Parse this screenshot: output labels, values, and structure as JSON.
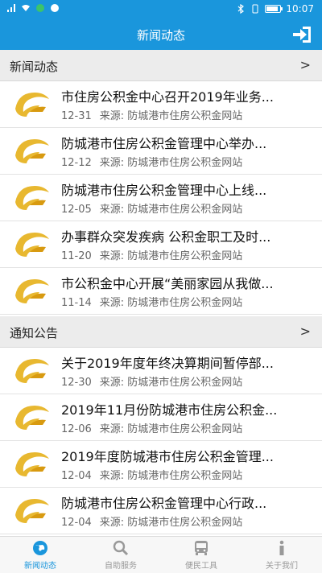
{
  "status_bar": {
    "time": "10:07"
  },
  "header": {
    "title": "新闻动态"
  },
  "sections": [
    {
      "label": "新闻动态",
      "more": ">",
      "items": [
        {
          "title": "市住房公积金中心召开2019年业务...",
          "date": "12-31",
          "source": "来源:  防城港市住房公积金网站"
        },
        {
          "title": "防城港市住房公积金管理中心举办...",
          "date": "12-12",
          "source": "来源:  防城港市住房公积金网站"
        },
        {
          "title": "防城港市住房公积金管理中心上线...",
          "date": "12-05",
          "source": "来源:  防城港市住房公积金网站"
        },
        {
          "title": "办事群众突发疾病 公积金职工及时...",
          "date": "11-20",
          "source": "来源:  防城港市住房公积金网站"
        },
        {
          "title": "市公积金中心开展“美丽家园从我做...",
          "date": "11-14",
          "source": "来源:  防城港市住房公积金网站"
        }
      ]
    },
    {
      "label": "通知公告",
      "more": ">",
      "items": [
        {
          "title": "关于2019年度年终决算期间暂停部...",
          "date": "12-30",
          "source": "来源:  防城港市住房公积金网站"
        },
        {
          "title": "2019年11月份防城港市住房公积金...",
          "date": "12-06",
          "source": "来源:  防城港市住房公积金网站"
        },
        {
          "title": "2019年度防城港市住房公积金管理...",
          "date": "12-04",
          "source": "来源:  防城港市住房公积金网站"
        },
        {
          "title": "防城港市住房公积金管理中心行政...",
          "date": "12-04",
          "source": "来源:  防城港市住房公积金网站"
        }
      ]
    }
  ],
  "tabs": [
    {
      "label": "新闻动态",
      "icon": "globe-icon",
      "active": true
    },
    {
      "label": "自助服务",
      "icon": "search-icon",
      "active": false
    },
    {
      "label": "便民工具",
      "icon": "bus-icon",
      "active": false
    },
    {
      "label": "关于我们",
      "icon": "info-icon",
      "active": false
    }
  ],
  "colors": {
    "primary": "#1a96dc",
    "logo_gold": "#e8b830"
  }
}
